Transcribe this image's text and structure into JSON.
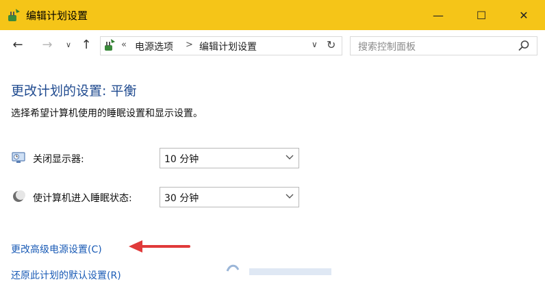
{
  "window": {
    "title": "编辑计划设置",
    "minimize_glyph": "—",
    "maximize_glyph": "☐",
    "close_glyph": "✕"
  },
  "navigation": {
    "back_glyph": "←",
    "forward_glyph": "→",
    "recent_glyph": "∨",
    "up_glyph": "↑"
  },
  "address_bar": {
    "prefix_glyph": "«",
    "breadcrumbs": [
      "电源选项",
      "编辑计划设置"
    ],
    "separator_glyph": ">",
    "dropdown_glyph": "∨",
    "refresh_glyph": "↻"
  },
  "search": {
    "placeholder": "搜索控制面板"
  },
  "main": {
    "title": "更改计划的设置: 平衡",
    "description": "选择希望计算机使用的睡眠设置和显示设置。",
    "settings": [
      {
        "label": "关闭显示器:",
        "value": "10 分钟",
        "icon": "monitor-icon"
      },
      {
        "label": "使计算机进入睡眠状态:",
        "value": "30 分钟",
        "icon": "sleep-moon-icon"
      }
    ],
    "links": [
      {
        "text": "更改高级电源设置(C)"
      },
      {
        "text": "还原此计划的默认设置(R)"
      }
    ]
  },
  "colors": {
    "titlebar": "#f5c518",
    "title_text": "#1f4a8f",
    "link": "#1a5bb6",
    "annotation_arrow": "#e03a3a"
  }
}
